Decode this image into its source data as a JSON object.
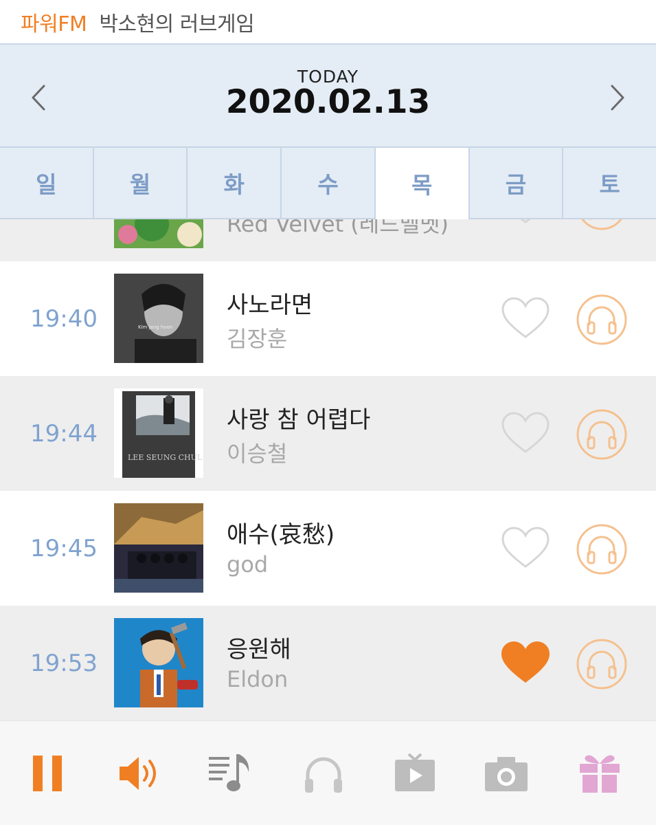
{
  "header": {
    "station": "파워FM",
    "program": "박소현의 러브게임"
  },
  "date_nav": {
    "label": "TODAY",
    "date": "2020.02.13"
  },
  "day_tabs": [
    {
      "label": "일",
      "active": false
    },
    {
      "label": "월",
      "active": false
    },
    {
      "label": "화",
      "active": false
    },
    {
      "label": "수",
      "active": false
    },
    {
      "label": "목",
      "active": true
    },
    {
      "label": "금",
      "active": false
    },
    {
      "label": "토",
      "active": false
    }
  ],
  "songs": [
    {
      "time": "",
      "title": "",
      "artist": "Red Velvet (레드벨벳)",
      "liked": false
    },
    {
      "time": "19:40",
      "title": "사노라면",
      "artist": "김장훈",
      "liked": false
    },
    {
      "time": "19:44",
      "title": "사랑 참 어렵다",
      "artist": "이승철",
      "liked": false
    },
    {
      "time": "19:45",
      "title": "애수(哀愁)",
      "artist": "god",
      "liked": false
    },
    {
      "time": "19:53",
      "title": "응원해",
      "artist": "Eldon",
      "liked": true
    }
  ],
  "album_art_text": {
    "kim": "Kim jang hoon",
    "lee": "LEE SEUNG CHUL"
  },
  "toolbar": [
    {
      "icon": "pause-icon"
    },
    {
      "icon": "volume-icon"
    },
    {
      "icon": "playlist-icon"
    },
    {
      "icon": "headphones-icon"
    },
    {
      "icon": "video-icon"
    },
    {
      "icon": "camera-icon"
    },
    {
      "icon": "gift-icon"
    }
  ],
  "colors": {
    "accent": "#f07f24",
    "tab_text": "#7d9cc6",
    "time_text": "#7fa3cf",
    "nav_bg": "#e4ecf5",
    "gift": "#e2a6d3"
  }
}
